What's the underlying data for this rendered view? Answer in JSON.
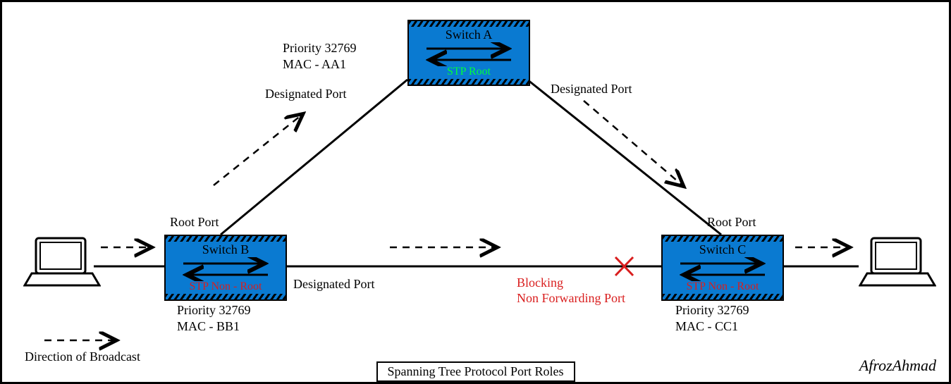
{
  "title": "Spanning Tree Protocol Port Roles",
  "author": "AfrozAhmad",
  "legend": "Direction of Broadcast",
  "switchA": {
    "name": "Switch A",
    "role": "STP Root",
    "priority": "Priority 32769",
    "mac": "MAC - AA1",
    "left_port": "Designated Port",
    "right_port": "Designated Port"
  },
  "switchB": {
    "name": "Switch B",
    "role": "STP Non - Root",
    "priority": "Priority 32769",
    "mac": "MAC - BB1",
    "top_port": "Root Port",
    "right_port": "Designated Port"
  },
  "switchC": {
    "name": "Switch C",
    "role": "STP Non - Root",
    "priority": "Priority 32769",
    "mac": "MAC - CC1",
    "top_port": "Root Port",
    "left_port_line1": "Blocking",
    "left_port_line2": "Non Forwarding Port"
  }
}
